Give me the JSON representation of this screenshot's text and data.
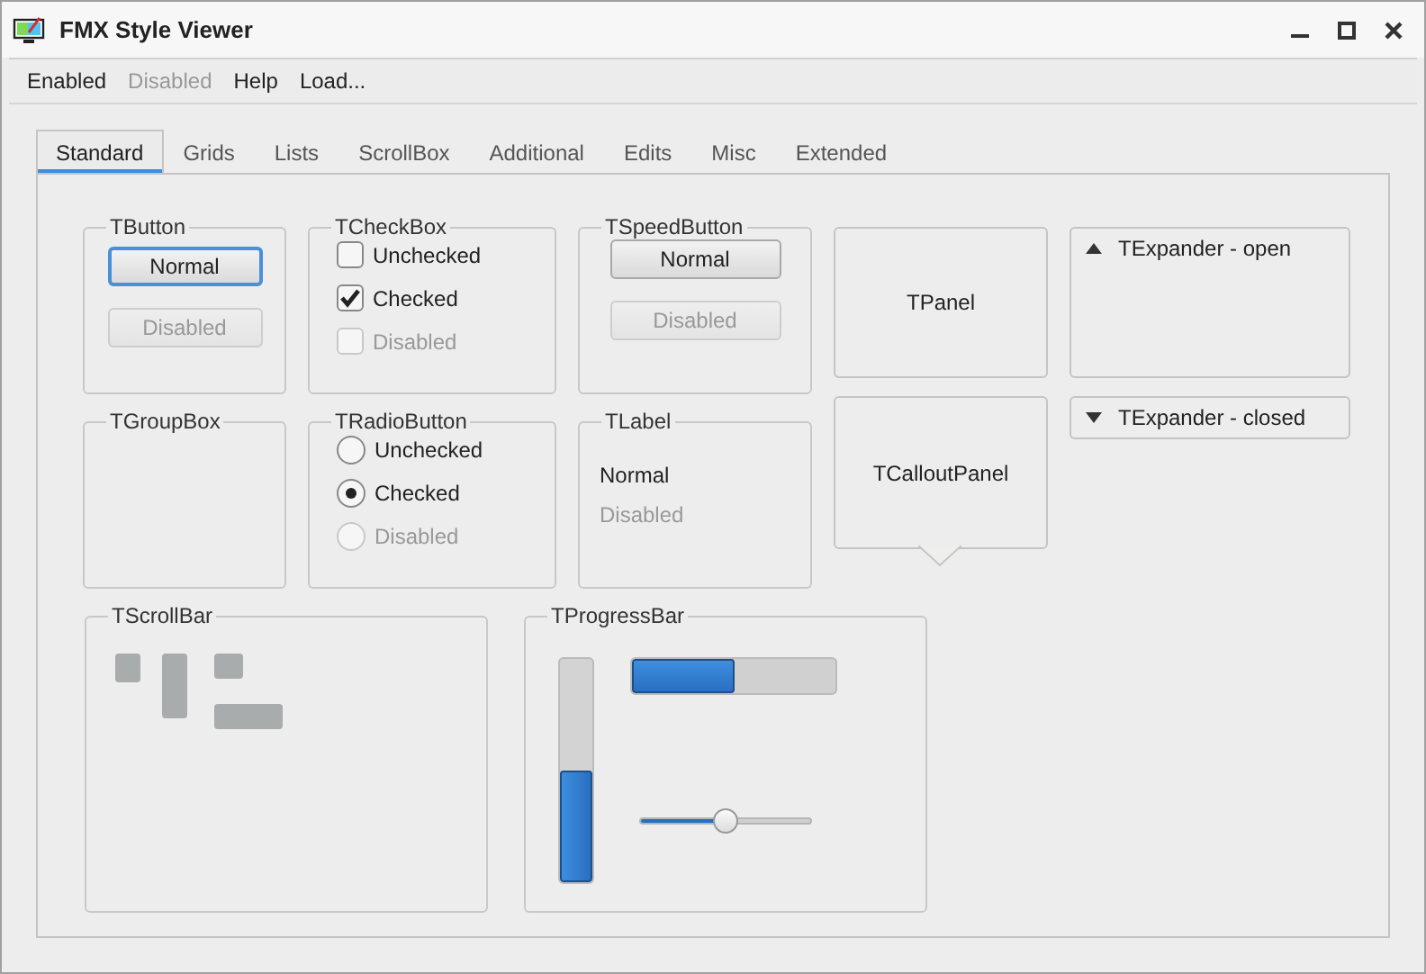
{
  "window": {
    "title": "FMX Style Viewer"
  },
  "menu": [
    {
      "label": "Enabled",
      "disabled": false
    },
    {
      "label": "Disabled",
      "disabled": true
    },
    {
      "label": "Help",
      "disabled": false
    },
    {
      "label": "Load...",
      "disabled": false
    }
  ],
  "tabs": [
    {
      "label": "Standard",
      "selected": true
    },
    {
      "label": "Grids",
      "selected": false
    },
    {
      "label": "Lists",
      "selected": false
    },
    {
      "label": "ScrollBox",
      "selected": false
    },
    {
      "label": "Additional",
      "selected": false
    },
    {
      "label": "Edits",
      "selected": false
    },
    {
      "label": "Misc",
      "selected": false
    },
    {
      "label": "Extended",
      "selected": false
    }
  ],
  "button_group": {
    "title": "TButton",
    "buttons": [
      {
        "label": "Normal",
        "disabled": false,
        "focused": true
      },
      {
        "label": "Disabled",
        "disabled": true,
        "focused": false
      }
    ]
  },
  "checkbox_group": {
    "title": "TCheckBox",
    "items": [
      {
        "label": "Unchecked",
        "checked": false,
        "disabled": false
      },
      {
        "label": "Checked",
        "checked": true,
        "disabled": false
      },
      {
        "label": "Disabled",
        "checked": false,
        "disabled": true
      }
    ]
  },
  "speed_button_group": {
    "title": "TSpeedButton",
    "buttons": [
      {
        "label": "Normal",
        "disabled": false
      },
      {
        "label": "Disabled",
        "disabled": true
      }
    ]
  },
  "panel": {
    "text": "TPanel"
  },
  "expanders": [
    {
      "title": "TExpander - open",
      "expanded": true
    },
    {
      "title": "TExpander - closed",
      "expanded": false
    }
  ],
  "group_box": {
    "title": "TGroupBox"
  },
  "radio_group": {
    "title": "TRadioButton",
    "items": [
      {
        "label": "Unchecked",
        "selected": false,
        "disabled": false
      },
      {
        "label": "Checked",
        "selected": true,
        "disabled": false
      },
      {
        "label": "Disabled",
        "selected": false,
        "disabled": true
      }
    ]
  },
  "label_group": {
    "title": "TLabel",
    "items": [
      {
        "text": "Normal",
        "disabled": false
      },
      {
        "text": "Disabled",
        "disabled": true
      }
    ]
  },
  "callout_panel": {
    "text": "TCalloutPanel"
  },
  "scrollbar_group": {
    "title": "TScrollBar"
  },
  "progress_group": {
    "title": "TProgressBar",
    "vertical": {
      "level": 0.5
    },
    "horizontal": {
      "level": 0.5
    },
    "slider": {
      "level": 0.5
    }
  }
}
